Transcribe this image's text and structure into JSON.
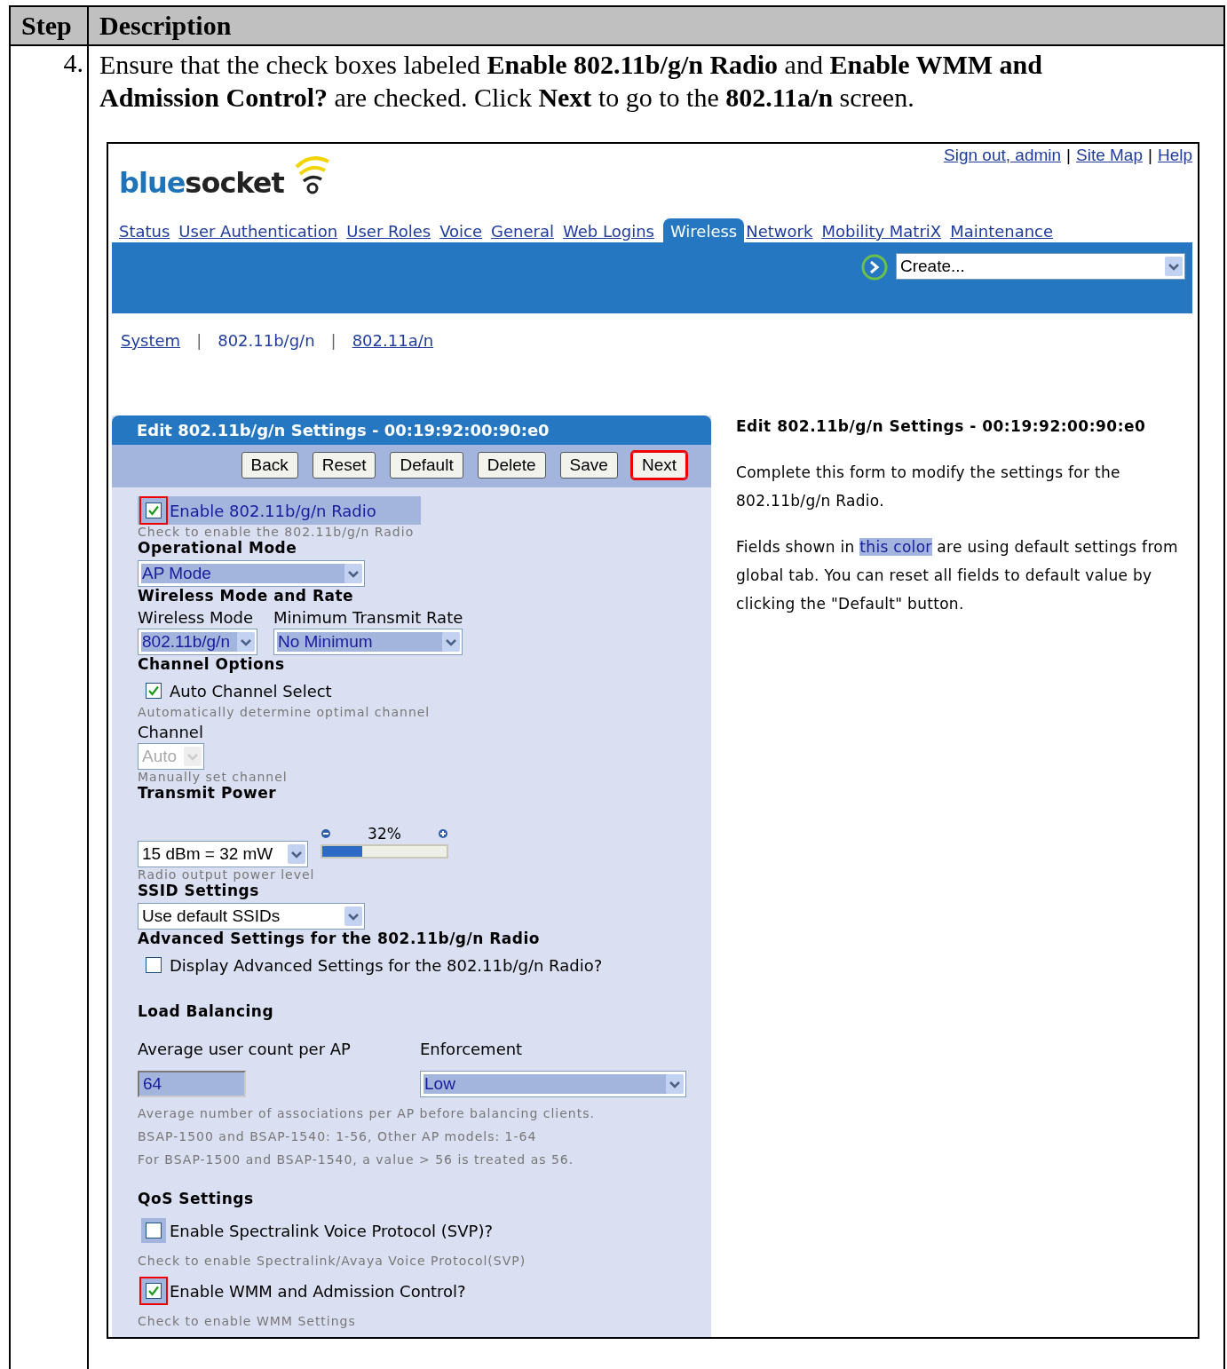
{
  "table": {
    "columns": [
      "Step",
      "Description"
    ],
    "rows": [
      {
        "step": "4.",
        "description": "Ensure that the check boxes labeled **Enable 802.11b/g/n Radio** and **Enable WMM and Admission Control?** are checked. Click **Next** to go to the **802.11a/n** screen."
      }
    ]
  },
  "screenshot": {
    "top_bar": [
      {
        "kind": "link",
        "text": "Sign out, admin"
      },
      {
        "kind": "separator",
        "text": "|"
      },
      {
        "kind": "link",
        "text": "Site Map"
      },
      {
        "kind": "separator",
        "text": "|"
      },
      {
        "kind": "link",
        "text": "Help"
      }
    ],
    "logo": {
      "first": "blue",
      "second": "socket"
    },
    "nav_tabs": [
      {
        "label": "Status",
        "selected": false
      },
      {
        "label": "User Authentication",
        "selected": false
      },
      {
        "label": "User Roles",
        "selected": false
      },
      {
        "label": "Voice",
        "selected": false
      },
      {
        "label": "General",
        "selected": false
      },
      {
        "label": "Web Logins",
        "selected": false
      },
      {
        "label": "Wireless",
        "selected": true
      },
      {
        "label": "Network",
        "selected": false
      },
      {
        "label": "Mobility MatriX",
        "selected": false
      },
      {
        "label": "Maintenance",
        "selected": false
      }
    ],
    "create_select": {
      "value": "Create..."
    },
    "subnav": [
      {
        "kind": "link",
        "text": "System",
        "selected": false
      },
      {
        "kind": "separator",
        "text": "|"
      },
      {
        "kind": "link",
        "text": "802.11b/g/n",
        "selected": true
      },
      {
        "kind": "separator",
        "text": "|"
      },
      {
        "kind": "link",
        "text": "802.11a/n",
        "selected": false
      }
    ],
    "panel": {
      "title": "Edit 802.11b/g/n Settings - 00:19:92:00:90:e0",
      "buttons": [
        {
          "label": "Back",
          "highlighted": false
        },
        {
          "label": "Reset",
          "highlighted": false
        },
        {
          "label": "Default",
          "highlighted": false
        },
        {
          "label": "Delete",
          "highlighted": false
        },
        {
          "label": "Save",
          "highlighted": false
        },
        {
          "label": "Next",
          "highlighted": true
        }
      ],
      "items": [
        {
          "kind": "checkbox",
          "label": "Enable 802.11b/g/n Radio",
          "checked": true,
          "highlighted": true,
          "default_row": true
        },
        {
          "kind": "hint",
          "text": "Check to enable the 802.11b/g/n Radio"
        },
        {
          "kind": "heading",
          "text": "Operational Mode"
        },
        {
          "kind": "controls",
          "controls": [
            {
              "kind": "select",
              "value": "AP Mode",
              "default": true
            }
          ]
        },
        {
          "kind": "heading",
          "text": "Wireless Mode and Rate"
        },
        {
          "kind": "controls",
          "controls": [
            {
              "kind": "select",
              "label": "Wireless Mode",
              "value": "802.11b/g/n",
              "default": true
            },
            {
              "kind": "select",
              "label": "Minimum Transmit Rate",
              "value": "No Minimum",
              "default": true
            }
          ]
        },
        {
          "kind": "heading",
          "text": "Channel Options"
        },
        {
          "kind": "checkbox",
          "label": "Auto Channel Select",
          "checked": true
        },
        {
          "kind": "hint",
          "text": "Automatically determine optimal channel"
        },
        {
          "kind": "controls",
          "controls": [
            {
              "kind": "select",
              "label": "Channel",
              "value": "Auto",
              "default": false,
              "disabled": true
            }
          ]
        },
        {
          "kind": "hint",
          "text": "Manually set channel"
        },
        {
          "kind": "heading",
          "text": "Transmit Power"
        },
        {
          "kind": "power",
          "value": "15 dBm = 32 mW",
          "reading": "32%",
          "level": 0.32
        },
        {
          "kind": "hint",
          "text": "Radio output power level"
        },
        {
          "kind": "heading",
          "text": "SSID Settings"
        },
        {
          "kind": "controls",
          "controls": [
            {
              "kind": "select",
              "value": "Use default SSIDs",
              "default": false
            }
          ]
        },
        {
          "kind": "heading",
          "text": "Advanced Settings for the 802.11b/g/n Radio"
        },
        {
          "kind": "checkbox",
          "label": "Display Advanced Settings for the 802.11b/g/n Radio?",
          "checked": false
        },
        {
          "kind": "section",
          "text": "Load Balancing"
        },
        {
          "kind": "controls",
          "controls": [
            {
              "kind": "input",
              "label": "Average user count per AP",
              "value": "64",
              "default": true
            },
            {
              "kind": "select",
              "label": "Enforcement",
              "value": "Low",
              "default": true
            }
          ]
        },
        {
          "kind": "note",
          "text": "Average number of associations per AP before balancing clients."
        },
        {
          "kind": "note",
          "text": "BSAP-1500 and BSAP-1540: 1-56, Other AP models: 1-64"
        },
        {
          "kind": "note",
          "text": "For BSAP-1500 and BSAP-1540, a value > 56 is treated as 56."
        },
        {
          "kind": "section",
          "text": "QoS Settings"
        },
        {
          "kind": "checkbox",
          "label": "Enable Spectralink Voice Protocol (SVP)?",
          "checked": false,
          "default": true,
          "highlighted": false
        },
        {
          "kind": "note",
          "text": "Check to enable Spectralink/Avaya Voice Protocol(SVP)"
        },
        {
          "kind": "checkbox",
          "label": "Enable WMM and Admission Control?",
          "checked": true,
          "default": true,
          "highlighted": true
        },
        {
          "kind": "note",
          "text": "Check to enable WMM Settings"
        }
      ]
    },
    "help": {
      "title": "Edit 802.11b/g/n Settings - 00:19:92:00:90:e0",
      "paragraph_1": "Complete this form to modify the settings for the 802.11b/g/n Radio.",
      "paragraph_2": {
        "before": "Fields shown in",
        "highlight": "this color",
        "after": "are using default settings from global tab. You can reset all fields to default value by clicking the \"Default\" button."
      }
    }
  }
}
